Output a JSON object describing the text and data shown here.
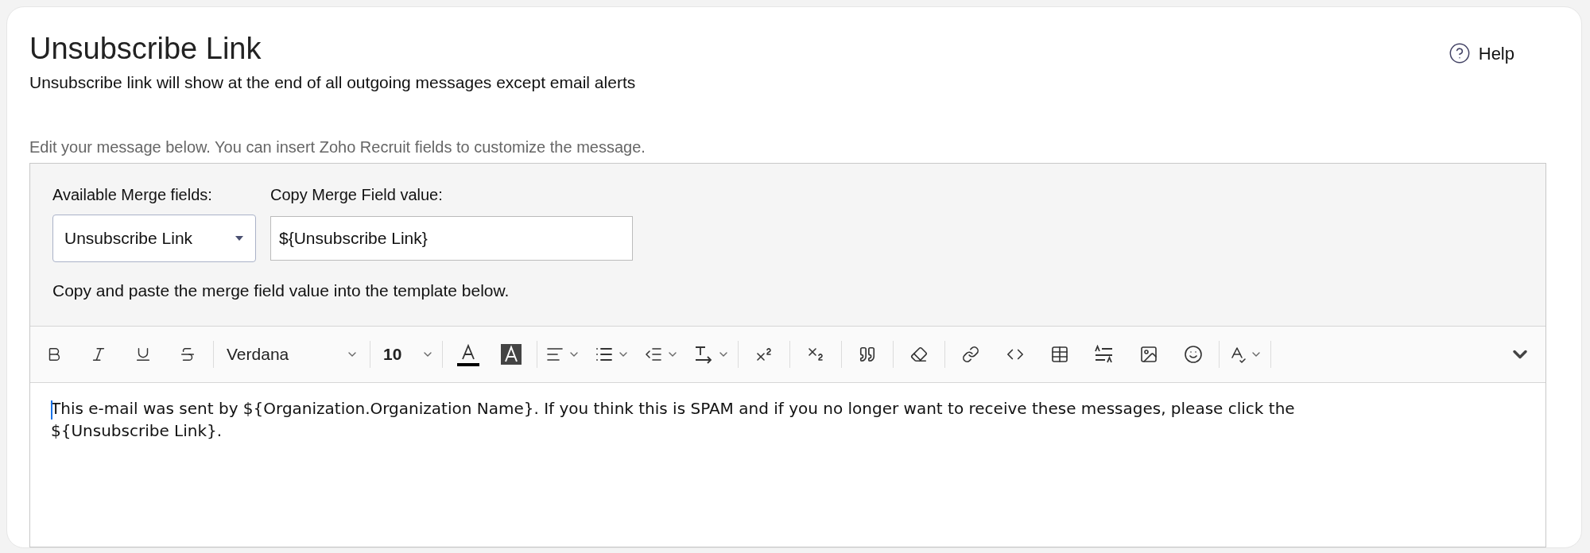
{
  "header": {
    "title": "Unsubscribe Link",
    "subtitle": "Unsubscribe link will show at the end of all outgoing messages except email alerts",
    "help": "Help"
  },
  "hint": "Edit your message below. You can insert Zoho Recruit fields to customize the message.",
  "merge": {
    "fields_label": "Available Merge fields:",
    "fields_value": "Unsubscribe Link",
    "copy_label": "Copy Merge Field value:",
    "copy_value": "${Unsubscribe Link}",
    "note": "Copy and paste the merge field value into the template below."
  },
  "toolbar": {
    "font": "Verdana",
    "size": "10"
  },
  "editor": {
    "lines": [
      "This e-mail was sent by ${Organization.Organization Name}. If you think this is SPAM and if you no longer want to receive these messages, please click the",
      "${Unsubscribe Link}."
    ]
  }
}
